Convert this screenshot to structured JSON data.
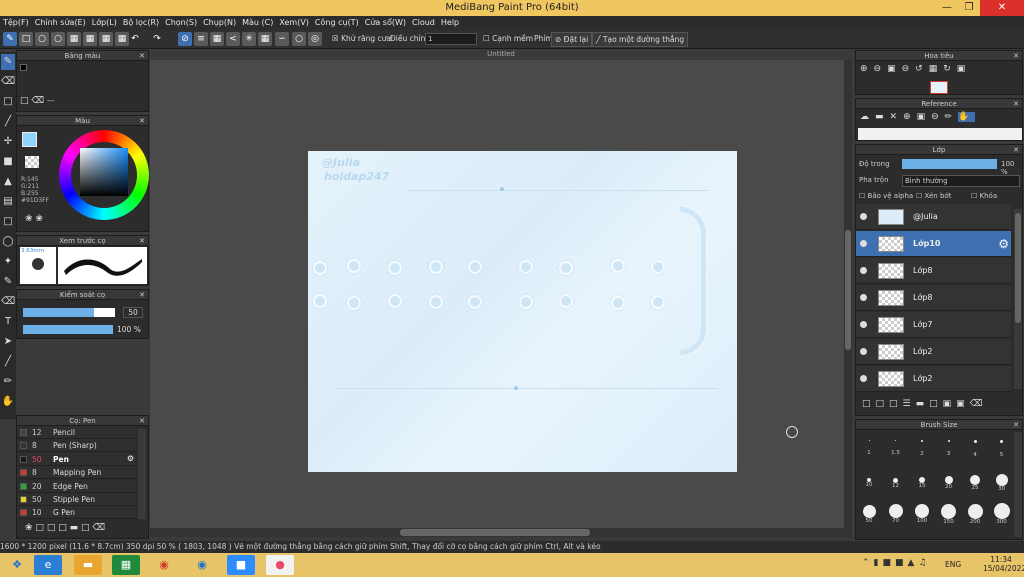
{
  "app": {
    "title": "MediBang Paint Pro (64bit)"
  },
  "menu": [
    "Tệp(F)",
    "Chỉnh sửa(E)",
    "Lớp(L)",
    "Bộ lọc(R)",
    "Chọn(S)",
    "Chụp(N)",
    "Màu (C)",
    "Xem(V)",
    "Công cụ(T)",
    "Cửa sổ(W)",
    "Cloud",
    "Help"
  ],
  "toolbar": {
    "antialias": "Khử răng cưa",
    "correction_label": "Điều chỉnh",
    "correction_value": "1",
    "smooth": "Cạnh mềm",
    "key_label": "Phím",
    "reset": "Đặt lại",
    "straight_line": "Tạo một đường thẳng"
  },
  "doc": {
    "tab": "Untitled"
  },
  "canvas": {
    "watermark1": "@Julia",
    "watermark2": "hoidap247"
  },
  "panels": {
    "color_bar": "Bảng màu",
    "color": "Màu",
    "color_values": {
      "r": "R:145",
      "g": "G:211",
      "b": "B:255",
      "hex": "#91D3FF"
    },
    "preview": "Xem trước cọ",
    "preview_size": "3.63mm",
    "brush_control": "Kiểm soát cọ",
    "brush_size_value": "50",
    "brush_opacity_value": "100 %",
    "brush_list_title": "Cọ: Pen",
    "navigator": "Hoa tiêu",
    "reference": "Reference",
    "layer": "Lớp",
    "opacity_label": "Độ trong",
    "opacity_value": "100 %",
    "blend_label": "Pha trộn",
    "blend_value": "Bình thường",
    "protect_alpha": "Bảo vệ alpha",
    "clipping": "Xén bớt",
    "lock": "Khóa",
    "brush_size": "Brush Size"
  },
  "brushes": [
    {
      "size": "12",
      "name": "Pencil",
      "color": "#444"
    },
    {
      "size": "8",
      "name": "Pen (Sharp)",
      "color": "#333"
    },
    {
      "size": "50",
      "name": "Pen",
      "color": "#1a1a1a"
    },
    {
      "size": "8",
      "name": "Mapping Pen",
      "color": "#d23a2a"
    },
    {
      "size": "20",
      "name": "Edge Pen",
      "color": "#2ea83a"
    },
    {
      "size": "50",
      "name": "Stipple Pen",
      "color": "#e6d22a"
    },
    {
      "size": "10",
      "name": "G Pen",
      "color": "#d23a2a"
    }
  ],
  "layers": [
    "@Julia",
    "Lớp10",
    "Lớp8",
    "Lớp8",
    "Lớp7",
    "Lớp2",
    "Lớp2"
  ],
  "brush_sizes": {
    "row1": [
      ".",
      ".",
      ".",
      ".",
      ".",
      "."
    ],
    "row1_labels": [
      "1",
      "1.5",
      "2",
      "3",
      "4",
      "5"
    ],
    "row2_labels": [
      "10",
      "12",
      "15",
      "20",
      "25",
      "30"
    ],
    "row3_labels": [
      "50",
      "70",
      "100",
      "150",
      "200",
      "300"
    ]
  },
  "status": "1600 * 1200 pixel   (11.6 * 8.7cm)   350 dpi   50 %   ( 1803, 1048 )   Vẽ một đường thẳng bằng cách giữ phím Shift, Thay đổi cỡ cọ bằng cách giữ phím Ctrl, Alt và kéo",
  "taskbar": {
    "lang": "ENG",
    "time": "11:34",
    "date": "15/04/2022"
  }
}
